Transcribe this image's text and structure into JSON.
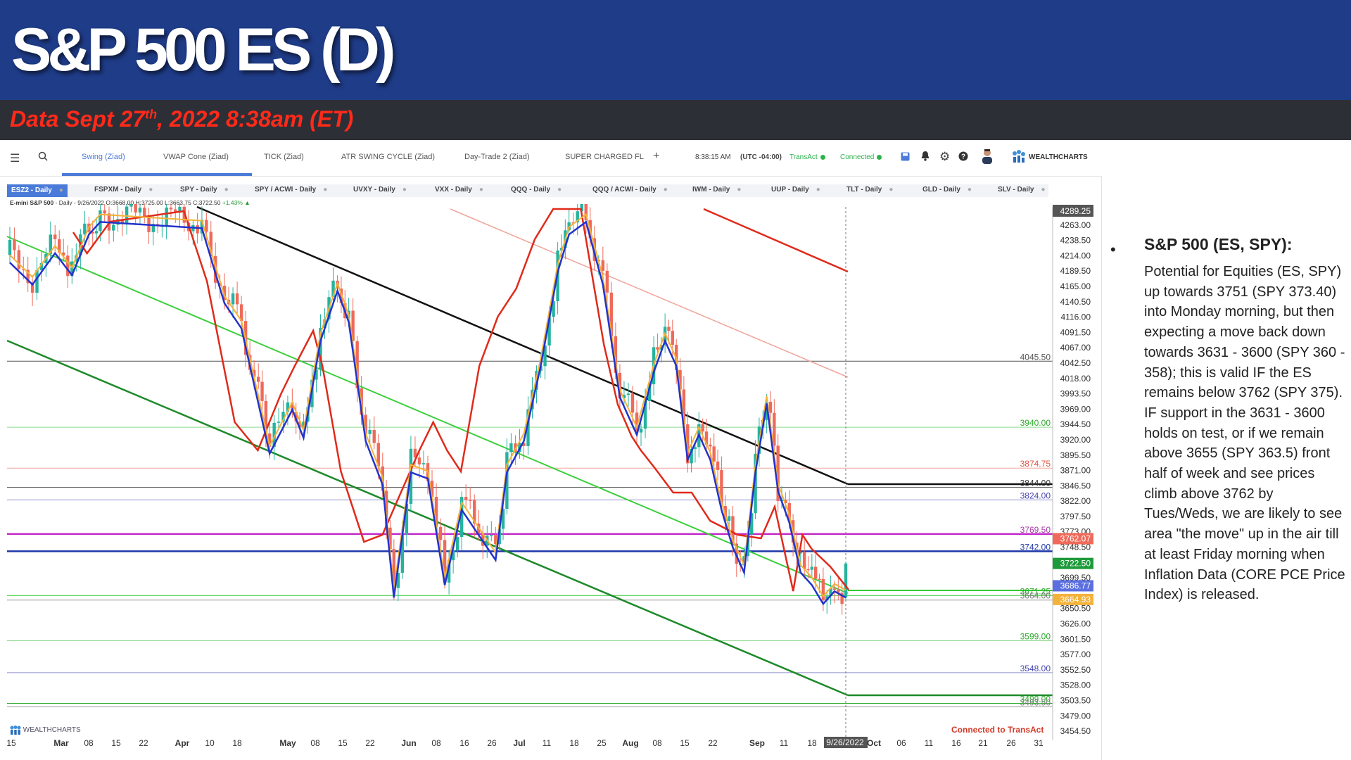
{
  "slide": {
    "title": "S&P 500 ES (D)",
    "subtitle_main": "Data Sept 27",
    "subtitle_sup": "th",
    "subtitle_rest": ", 2022 8:38am (ET)"
  },
  "toolbar": {
    "menu_icon": "hamburger-icon",
    "search_icon": "search-icon",
    "tabs": [
      "Swing (Ziad)",
      "VWAP Cone (Ziad)",
      "TICK (Ziad)",
      "ATR SWING CYCLE (Ziad)",
      "Day-Trade 2 (Ziad)",
      "SUPER CHARGED FL"
    ],
    "add_tab": "+",
    "time": "8:38:15 AM",
    "timezone": "(UTC -04:00)",
    "transact": "TransAct",
    "connected": "Connected",
    "brand": "WEALTHCHARTS",
    "accent": "#4b7bd8"
  },
  "symbols": [
    "ESZ2 - Daily",
    "FSPXM - Daily",
    "SPY - Daily",
    "SPY / ACWI - Daily",
    "UVXY - Daily",
    "VXX - Daily",
    "QQQ - Daily",
    "QQQ / ACWI - Daily",
    "IWM - Daily",
    "UUP - Daily",
    "TLT - Daily",
    "GLD - Daily",
    "SLV - Daily"
  ],
  "ohlc_line": {
    "name": "E-mini S&P 500",
    "detail": "- Daily - 9/26/2022 O:3668.00 H:3725.00 L:3663.75 C:3722.50",
    "change": "+1.43%"
  },
  "chart_data": {
    "type": "candlestick",
    "instrument": "ESZ2 Daily",
    "x_ticks": [
      "15",
      "Mar",
      "08",
      "15",
      "22",
      "Apr",
      "10",
      "18",
      "May",
      "08",
      "15",
      "22",
      "Jun",
      "08",
      "16",
      "26",
      "Jul",
      "11",
      "18",
      "25",
      "Aug",
      "08",
      "15",
      "22",
      "Sep",
      "11",
      "18",
      "9/26/2022",
      "Oct",
      "06",
      "11",
      "16",
      "21",
      "26",
      "31"
    ],
    "y_ticks": [
      4263.0,
      4238.5,
      4214.0,
      4189.5,
      4165.0,
      4140.5,
      4116.0,
      4091.5,
      4067.0,
      4042.5,
      4018.0,
      3993.5,
      3969.0,
      3944.5,
      3920.0,
      3895.5,
      3871.0,
      3846.5,
      3822.0,
      3797.5,
      3773.0,
      3748.5,
      3699.5,
      3650.5,
      3626.0,
      3601.5,
      3577.0,
      3552.5,
      3528.0,
      3503.5,
      3479.0,
      3454.5
    ],
    "ylim": [
      3440,
      4292
    ],
    "top_label": "4289.25",
    "price_labels": [
      {
        "value": 3762.07,
        "color": "#ef6a5a"
      },
      {
        "value": 3722.5,
        "color": "#1d9a3a"
      },
      {
        "value": 3686.77,
        "color": "#5b6fe0"
      },
      {
        "value": 3664.93,
        "color": "#f3b23a"
      }
    ],
    "horizontal_levels": [
      {
        "value": 4045.5,
        "label": "4045.50",
        "color": "#555555",
        "label_color": "#555555"
      },
      {
        "value": 3940.0,
        "label": "3940.00",
        "color": "#8ed98e",
        "label_color": "#2faa2f"
      },
      {
        "value": 3874.75,
        "label": "3874.75",
        "color": "#f0a49a",
        "label_color": "#e05545"
      },
      {
        "value": 3844.0,
        "label": "3844.00",
        "color": "#555555",
        "label_color": "#333333"
      },
      {
        "value": 3824.0,
        "label": "3824.00",
        "color": "#8f8fcf",
        "label_color": "#4545b0"
      },
      {
        "value": 3769.5,
        "label": "3769.50",
        "color": "#c228c9",
        "label_color": "#aa3aa8"
      },
      {
        "value": 3742.0,
        "label": "3742.00",
        "color": "#1d37a8",
        "label_color": "#1d37a8"
      },
      {
        "value": 3671.25,
        "label": "3671.25",
        "color": "#33cc33",
        "label_color": "#2faa2f"
      },
      {
        "value": 3664.0,
        "label": "3664.00",
        "color": "#999999",
        "label_color": "#777777"
      },
      {
        "value": 3599.0,
        "label": "3599.00",
        "color": "#8ed98e",
        "label_color": "#2faa2f"
      },
      {
        "value": 3548.0,
        "label": "3548.00",
        "color": "#8f8fcf",
        "label_color": "#4545b0"
      },
      {
        "value": 3499.0,
        "label": "3499.00",
        "color": "#2faa2f",
        "label_color": "#2faa2f"
      },
      {
        "value": 3493.5,
        "label": "3493.50",
        "color": "#999999",
        "label_color": "#777777"
      }
    ],
    "colors": {
      "up": "#25b39e",
      "down": "#ef6a5a",
      "ema_fast": "#2233cc",
      "ema_slow": "#e02a1a",
      "ema_mid": "#f3b23a"
    }
  },
  "footer": {
    "connected_note": "Connected to TransAct",
    "brand": "WEALTHCHARTS"
  },
  "commentary": {
    "heading": "S&P 500 (ES, SPY):",
    "body": "Potential for Equities (ES, SPY) up towards 3751 (SPY 373.40) into Monday morning,  but then expecting a move back down towards 3631 - 3600 (SPY 360 - 358); this is valid IF the ES remains below 3762 (SPY 375). IF support in the 3631 - 3600 holds on test, or if we remain above 3655 (SPY 363.5) front half of week and see prices climb above 3762 by Tues/Weds, we are likely to see area \"the move\" up in the air till at least Friday morning when Inflation Data (CORE PCE Price Index) is released."
  }
}
